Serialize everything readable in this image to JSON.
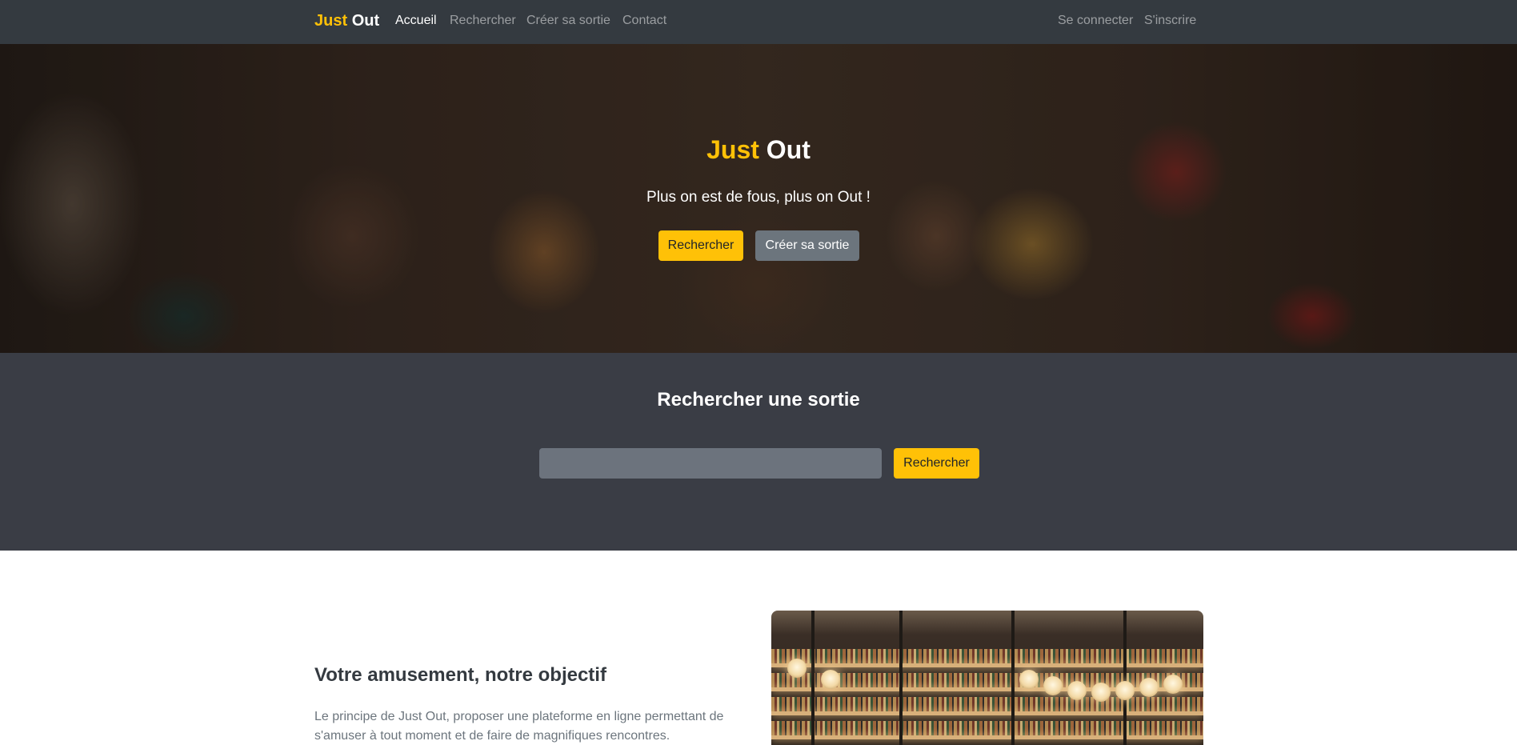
{
  "navbar": {
    "brand_part1": "Just",
    "brand_part2": "Out",
    "links": [
      {
        "label": "Accueil",
        "active": true
      },
      {
        "label": "Rechercher",
        "active": false
      },
      {
        "label": "Créer sa sortie",
        "active": false
      },
      {
        "label": "Contact",
        "active": false
      }
    ],
    "right_links": [
      {
        "label": "Se connecter"
      },
      {
        "label": "S'inscrire"
      }
    ]
  },
  "hero": {
    "title_part1": "Just",
    "title_part2": "Out",
    "subtitle": "Plus on est de fous, plus on Out !",
    "primary_button": "Rechercher",
    "secondary_button": "Créer sa sortie"
  },
  "search": {
    "title": "Rechercher une sortie",
    "input_value": "",
    "button": "Rechercher"
  },
  "about": {
    "title": "Votre amusement, notre objectif",
    "text": "Le principe de Just Out, proposer une plateforme en ligne permettant de s'amuser à tout moment et de faire de magnifiques rencontres."
  },
  "colors": {
    "navbar_bg": "#343a40",
    "accent_yellow": "#ffc107",
    "search_section_bg": "#3a3d45",
    "secondary_button": "#6c757d"
  }
}
